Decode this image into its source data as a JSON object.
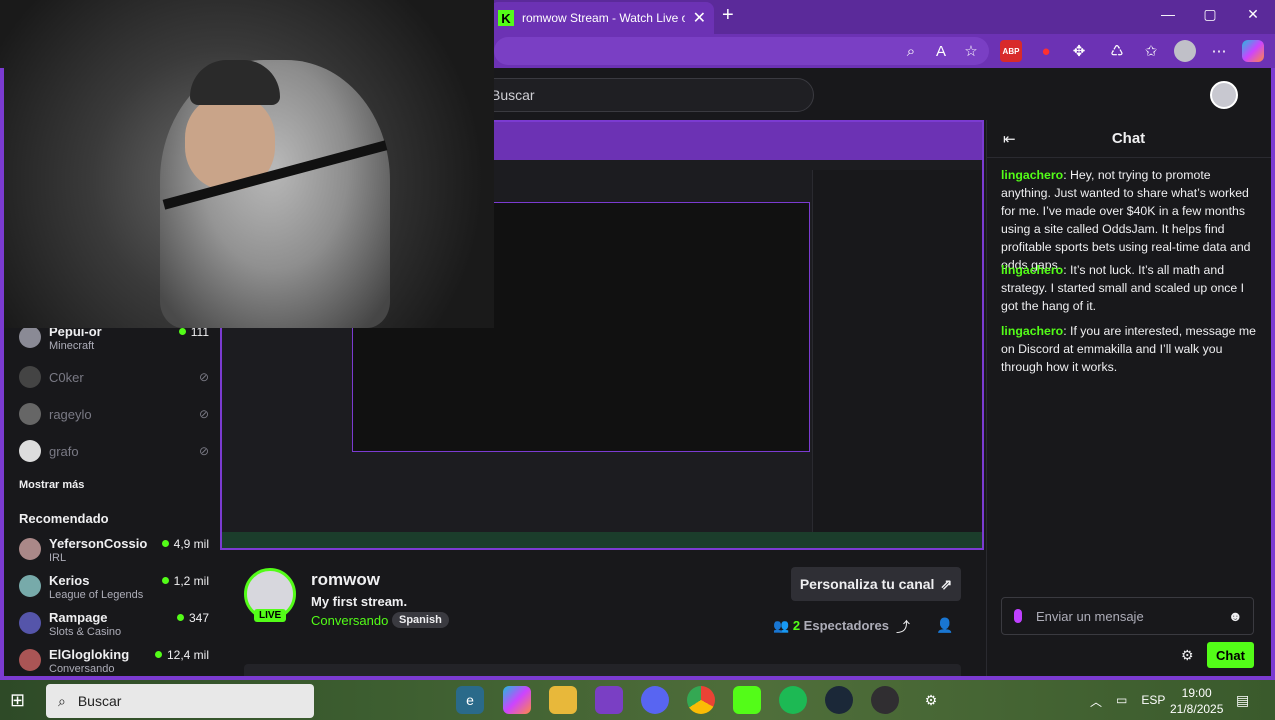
{
  "browser": {
    "tab_title": "romwow Stream - Watch Live on",
    "tab_close": "✕",
    "new_tab": "+",
    "win_min": "—",
    "win_max": "▢",
    "win_close": "✕",
    "abp": "ABP"
  },
  "header": {
    "search_placeholder": "Buscar"
  },
  "sidebar": {
    "channels": [
      {
        "name": "Pepui-or",
        "sub": "Minecraft",
        "count": "111",
        "online": true
      },
      {
        "name": "C0ker",
        "online": false
      },
      {
        "name": "rageylo",
        "online": false
      },
      {
        "name": "grafo",
        "online": false
      }
    ],
    "show_more": "Mostrar más",
    "recommended_title": "Recomendado",
    "recommended": [
      {
        "name": "YefersonCossio",
        "sub": "IRL",
        "count": "4,9 mil"
      },
      {
        "name": "Kerios",
        "sub": "League of Legends",
        "count": "1,2 mil"
      },
      {
        "name": "Rampage",
        "sub": "Slots & Casino",
        "count": "347"
      },
      {
        "name": "ElGlogloking",
        "sub": "Conversando",
        "count": "12,4 mil"
      }
    ]
  },
  "stream": {
    "streamer": "romwow",
    "title": "My first stream.",
    "category": "Conversando",
    "language": "Spanish",
    "live_badge": "LIVE",
    "customize": "Personaliza tu canal",
    "viewers_count": "2",
    "viewers_label": "Espectadores"
  },
  "chat": {
    "title": "Chat",
    "messages": [
      {
        "user": "lingachero",
        "text": "Hey, not trying to promote anything. Just wanted to share what’s worked for me. I’ve made over $40K in a few months using a site called OddsJam. It helps find profitable sports bets using real-time data and odds gaps."
      },
      {
        "user": "lingachero",
        "text": "It’s not luck. It’s all math and strategy. I started small and scaled up once I got the hang of it."
      },
      {
        "user": "lingachero",
        "text": "If you are interested, message me on Discord at emmakilla and I’ll walk you through how it works."
      }
    ],
    "input_placeholder": "Enviar un mensaje",
    "send": "Chat"
  },
  "taskbar": {
    "search": "Buscar",
    "lang": "ESP",
    "time": "19:00",
    "date": "21/8/2025"
  },
  "colors": {
    "kick_green": "#53fc18",
    "browser_purple": "#6c32b4",
    "bg": "#18181b"
  }
}
